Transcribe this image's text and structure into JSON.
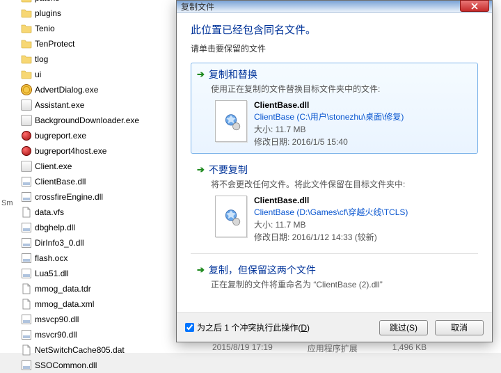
{
  "files": [
    {
      "name": "patcns",
      "type": "folder"
    },
    {
      "name": "plugins",
      "type": "folder"
    },
    {
      "name": "Tenio",
      "type": "folder"
    },
    {
      "name": "TenProtect",
      "type": "folder"
    },
    {
      "name": "tlog",
      "type": "folder"
    },
    {
      "name": "ui",
      "type": "folder"
    },
    {
      "name": "AdvertDialog.exe",
      "type": "gear"
    },
    {
      "name": "Assistant.exe",
      "type": "box"
    },
    {
      "name": "BackgroundDownloader.exe",
      "type": "exe"
    },
    {
      "name": "bugreport.exe",
      "type": "bug"
    },
    {
      "name": "bugreport4host.exe",
      "type": "bug"
    },
    {
      "name": "Client.exe",
      "type": "box"
    },
    {
      "name": "ClientBase.dll",
      "type": "dll"
    },
    {
      "name": "crossfireEngine.dll",
      "type": "dll"
    },
    {
      "name": "data.vfs",
      "type": "blank"
    },
    {
      "name": "dbghelp.dll",
      "type": "dll"
    },
    {
      "name": "DirInfo3_0.dll",
      "type": "dll"
    },
    {
      "name": "flash.ocx",
      "type": "dll"
    },
    {
      "name": "Lua51.dll",
      "type": "dll"
    },
    {
      "name": "mmog_data.tdr",
      "type": "blank"
    },
    {
      "name": "mmog_data.xml",
      "type": "blank"
    },
    {
      "name": "msvcp90.dll",
      "type": "dll"
    },
    {
      "name": "msvcr90.dll",
      "type": "dll"
    },
    {
      "name": "NetSwitchCache805.dat",
      "type": "blank"
    },
    {
      "name": "SSOCommon.dll",
      "type": "dll"
    }
  ],
  "badge": "Sm",
  "dialog": {
    "title": "复制文件",
    "headline": "此位置已经包含同名文件。",
    "subhead": "请单击要保留的文件",
    "opt1": {
      "title": "复制和替换",
      "sub": "使用正在复制的文件替换目标文件夹中的文件:",
      "fname": "ClientBase.dll",
      "fpath": "ClientBase (C:\\用户\\stonezhu\\桌面\\修复)",
      "fsize": "大小: 11.7 MB",
      "fdate": "修改日期: 2016/1/5 15:40"
    },
    "opt2": {
      "title": "不要复制",
      "sub": "将不会更改任何文件。将此文件保留在目标文件夹中:",
      "fname": "ClientBase.dll",
      "fpath": "ClientBase (D:\\Games\\cf\\穿越火线\\TCLS)",
      "fsize": "大小: 11.7 MB",
      "fdate": "修改日期: 2016/1/12 14:33 (较新)"
    },
    "opt3": {
      "title": "复制，但保留这两个文件",
      "sub": "正在复制的文件将重命名为 “ClientBase (2).dll”"
    },
    "footer": {
      "checkbox_prefix": "为之后",
      "checkbox_count": " 1 ",
      "checkbox_suffix": "个冲突执行此操作(",
      "checkbox_accel": "D",
      "checkbox_end": ")",
      "skip": "跳过(S)",
      "cancel": "取消"
    }
  },
  "bottom": {
    "date": "2015/8/19 17:19",
    "type": "应用程序扩展",
    "size": "1,496 KB"
  }
}
